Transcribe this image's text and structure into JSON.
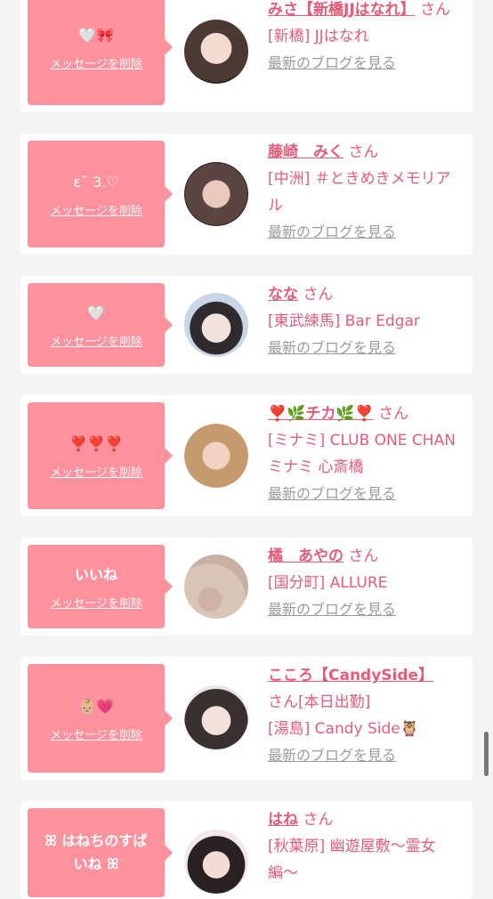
{
  "delete_label": "メッセージを削除",
  "blog_label": "最新のブログを見る",
  "san": "さん",
  "items": [
    {
      "message": "🤍🎀",
      "name": "みさ【新橋JJはなれ】",
      "san_after": "さん",
      "shop": "[新橋] JJはなれ"
    },
    {
      "message": "ε˘ 3.♡",
      "name": "藤崎　みく",
      "san_after": "さん",
      "shop": "[中洲] ＃ときめきメモリアル"
    },
    {
      "message": "🤍",
      "name": "なな",
      "san_after": "さん",
      "shop": "[東武練馬] Bar Edgar"
    },
    {
      "message": "❣️❣️❣️",
      "name": "❣️🌿チカ🌿❣️",
      "san_after": "さん",
      "shop": "[ミナミ] CLUB ONE CHAN ミナミ 心斎橋"
    },
    {
      "message": "いいね",
      "name": "橘　あやの",
      "san_after": "さん",
      "shop": "[国分町] ALLURE"
    },
    {
      "message": "👶🏼💗",
      "name": "こころ【CandySide】",
      "san_after": "さん[本日出勤]",
      "shop": "[湯島] Candy Side🦉"
    },
    {
      "message": "ꕤ はねちのすばいね ꕤ",
      "name": "はね",
      "san_after": "さん",
      "shop": "[秋葉原] 幽遊屋敷〜霊女編〜"
    }
  ],
  "colors": {
    "accent": "#fd919e",
    "name": "#e45c79",
    "link_gray": "#9b9b9b",
    "bg": "#f4f4f4"
  }
}
